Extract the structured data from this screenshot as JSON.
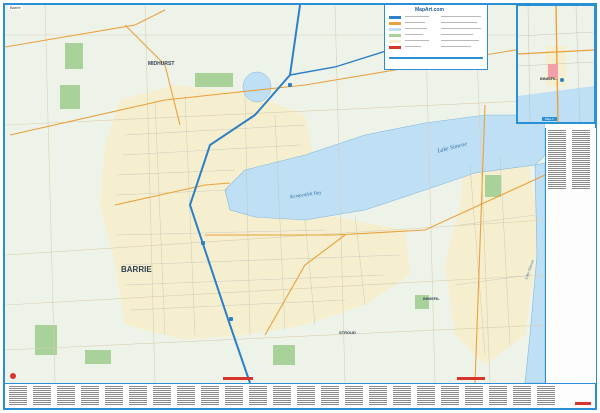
{
  "sheet": {
    "label": "Barrie"
  },
  "places": {
    "barrie": "BARRIE",
    "midhurst": "MIDHURST",
    "innisfil": "INNISFIL",
    "innisfil_inset": "INNISFIL",
    "stroud": "STROUD"
  },
  "water": {
    "lake_simcoe": "Lake Simcoe",
    "lake_simcoe_side": "Lake Simcoe",
    "kempenfelt_bay": "Kempenfelt Bay"
  },
  "legend": {
    "title": "MapArt.com"
  },
  "inset": {
    "key_label": "Map A"
  },
  "colors": {
    "frame": "#2b8fd6",
    "land": "#eef3ea",
    "water": "#bfe0f4",
    "urban": "#f6efcf",
    "park": "#a9d19a",
    "highway": "#2d7fc6",
    "arterial": "#e9a13d",
    "accent_red": "#d7342b"
  },
  "icons": {
    "legend": "legend-box-icon",
    "highway_shield": "highway-shield-icon"
  }
}
